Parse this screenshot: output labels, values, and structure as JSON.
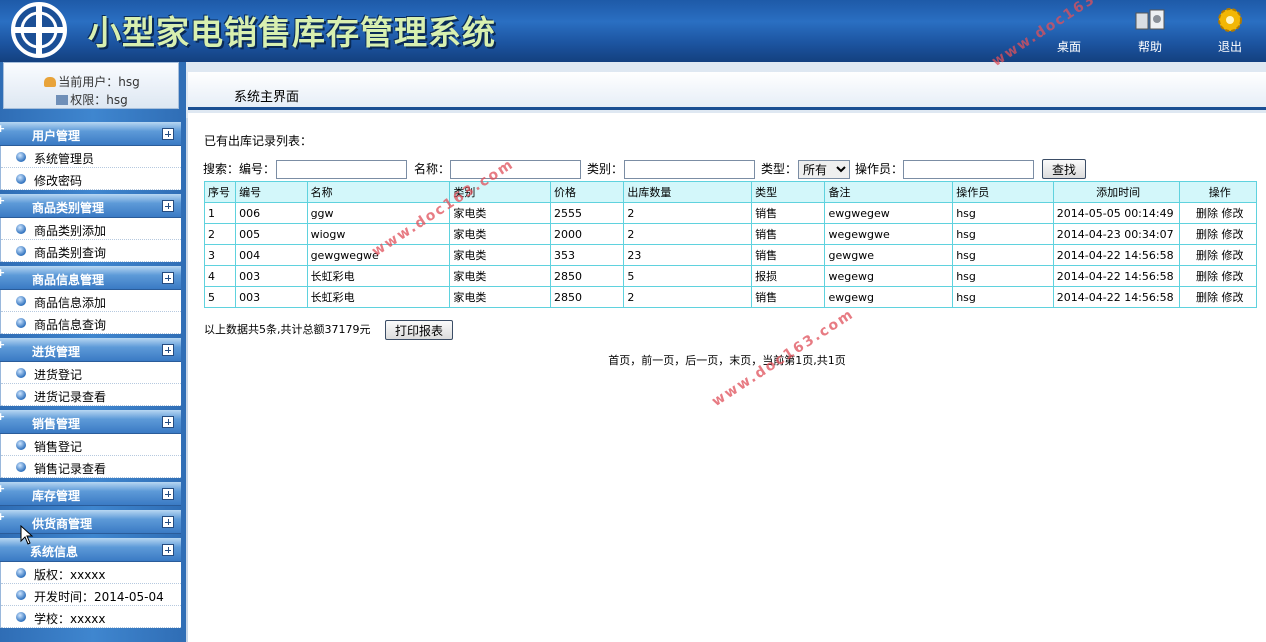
{
  "header": {
    "title": "小型家电销售库存管理系统",
    "tools": [
      {
        "label": "桌面",
        "icon": "desktop-icon"
      },
      {
        "label": "帮助",
        "icon": "help-icon"
      },
      {
        "label": "退出",
        "icon": "exit-gear-icon"
      }
    ]
  },
  "user": {
    "current_user": "当前用户：hsg",
    "permission": "权限：hsg"
  },
  "menu": [
    {
      "title": "用户管理",
      "items": [
        "系统管理员",
        "修改密码"
      ]
    },
    {
      "title": "商品类别管理",
      "items": [
        "商品类别添加",
        "商品类别查询"
      ]
    },
    {
      "title": "商品信息管理",
      "items": [
        "商品信息添加",
        "商品信息查询"
      ]
    },
    {
      "title": "进货管理",
      "items": [
        "进货登记",
        "进货记录查看"
      ]
    },
    {
      "title": "销售管理",
      "items": [
        "销售登记",
        "销售记录查看"
      ]
    },
    {
      "title": "库存管理",
      "items": []
    },
    {
      "title": "供货商管理",
      "items": []
    },
    {
      "title": "系统信息",
      "items": [
        "版权：xxxxx",
        "开发时间：2014-05-04",
        "学校：xxxxx"
      ]
    }
  ],
  "breadcrumb": "系统主界面",
  "main": {
    "list_title": "已有出库记录列表：",
    "search": {
      "label": "搜索：",
      "code_label": "编号：",
      "name_label": "名称：",
      "category_label": "类别：",
      "type_label": "类型：",
      "type_selected": "所有",
      "operator_label": "操作员：",
      "search_button": "查找"
    },
    "columns": [
      "序号",
      "编号",
      "名称",
      "类别",
      "价格",
      "出库数量",
      "类型",
      "备注",
      "操作员",
      "添加时间",
      "操作"
    ],
    "rows": [
      [
        "1",
        "006",
        "ggw",
        "家电类",
        "2555",
        "2",
        "销售",
        "ewgwegew",
        "hsg",
        "2014-05-05 00:14:49"
      ],
      [
        "2",
        "005",
        "wiogw",
        "家电类",
        "2000",
        "2",
        "销售",
        "wegewgwe",
        "hsg",
        "2014-04-23 00:34:07"
      ],
      [
        "3",
        "004",
        "gewgwegwe",
        "家电类",
        "353",
        "23",
        "销售",
        "gewgwe",
        "hsg",
        "2014-04-22 14:56:58"
      ],
      [
        "4",
        "003",
        "长虹彩电",
        "家电类",
        "2850",
        "5",
        "报损",
        "wegewg",
        "hsg",
        "2014-04-22 14:56:58"
      ],
      [
        "5",
        "003",
        "长虹彩电",
        "家电类",
        "2850",
        "2",
        "销售",
        "ewgewg",
        "hsg",
        "2014-04-22 14:56:58"
      ]
    ],
    "delete_label": "删除",
    "edit_label": "修改",
    "summary": "以上数据共5条,共计总额37179元",
    "print_button": "打印报表",
    "pager": "首页，前一页，后一页，末页，当前第1页,共1页"
  },
  "watermark": "www.doc163.com"
}
